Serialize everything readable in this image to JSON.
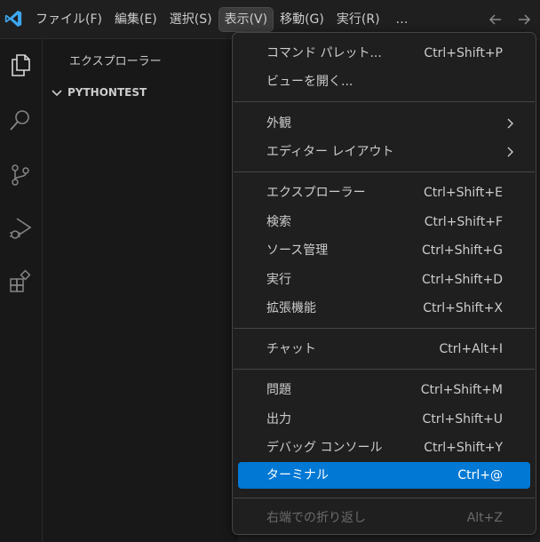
{
  "menubar": {
    "items": [
      "ファイル(F)",
      "編集(E)",
      "選択(S)",
      "表示(V)",
      "移動(G)",
      "実行(R)",
      "…"
    ]
  },
  "sidebar": {
    "title": "エクスプローラー",
    "folder": "PYTHONTEST"
  },
  "view_menu": {
    "items": [
      {
        "label": "コマンド パレット...",
        "shortcut": "Ctrl+Shift+P"
      },
      {
        "label": "ビューを開く...",
        "shortcut": ""
      },
      {
        "label": "外観",
        "shortcut": "",
        "submenu": true
      },
      {
        "label": "エディター レイアウト",
        "shortcut": "",
        "submenu": true
      },
      {
        "label": "エクスプローラー",
        "shortcut": "Ctrl+Shift+E"
      },
      {
        "label": "検索",
        "shortcut": "Ctrl+Shift+F"
      },
      {
        "label": "ソース管理",
        "shortcut": "Ctrl+Shift+G"
      },
      {
        "label": "実行",
        "shortcut": "Ctrl+Shift+D"
      },
      {
        "label": "拡張機能",
        "shortcut": "Ctrl+Shift+X"
      },
      {
        "label": "チャット",
        "shortcut": "Ctrl+Alt+I"
      },
      {
        "label": "問題",
        "shortcut": "Ctrl+Shift+M"
      },
      {
        "label": "出力",
        "shortcut": "Ctrl+Shift+U"
      },
      {
        "label": "デバッグ コンソール",
        "shortcut": "Ctrl+Shift+Y"
      },
      {
        "label": "ターミナル",
        "shortcut": "Ctrl+@",
        "highlighted": true
      },
      {
        "label": "右端での折り返し",
        "shortcut": "Alt+Z",
        "disabled": true
      }
    ]
  },
  "colors": {
    "accent": "#0078d4",
    "background": "#1f1f1f",
    "menu_border": "#454545"
  },
  "icons": [
    "vscode-logo-icon",
    "explorer-icon",
    "search-icon",
    "source-control-icon",
    "run-debug-icon",
    "extensions-icon",
    "chevron-down-icon",
    "chevron-right-icon",
    "arrow-left-icon",
    "arrow-right-icon"
  ]
}
